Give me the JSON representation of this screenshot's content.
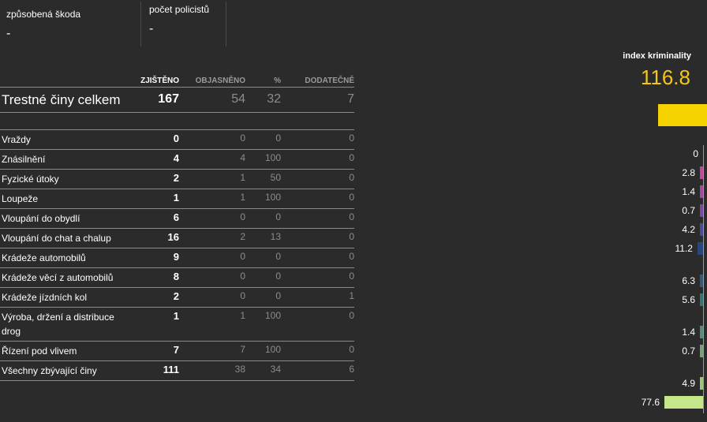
{
  "stats": [
    {
      "label": "způsobená škoda",
      "value": "-"
    },
    {
      "label": "počet policistů",
      "value": "-"
    }
  ],
  "table": {
    "headers": [
      "ZJIŠTĚNO",
      "OBJASNĚNO",
      "%",
      "DODATEČNĚ"
    ],
    "total": {
      "name": "Trestné činy celkem",
      "values": [
        "167",
        "54",
        "32",
        "7"
      ]
    },
    "rows": [
      {
        "name": "Vraždy",
        "values": [
          "0",
          "0",
          "0",
          "0"
        ]
      },
      {
        "name": "Znásilnění",
        "values": [
          "4",
          "4",
          "100",
          "0"
        ]
      },
      {
        "name": "Fyzické útoky",
        "values": [
          "2",
          "1",
          "50",
          "0"
        ]
      },
      {
        "name": "Loupeže",
        "values": [
          "1",
          "1",
          "100",
          "0"
        ]
      },
      {
        "name": "Vloupání do obydlí",
        "values": [
          "6",
          "0",
          "0",
          "0"
        ]
      },
      {
        "name": "Vloupání do chat a chalup",
        "values": [
          "16",
          "2",
          "13",
          "0"
        ]
      },
      {
        "name": "Krádeže automobilů",
        "values": [
          "9",
          "0",
          "0",
          "0"
        ]
      },
      {
        "name": "Krádeže věcí z automobilů",
        "values": [
          "8",
          "0",
          "0",
          "0"
        ]
      },
      {
        "name": "Krádeže jízdních kol",
        "values": [
          "2",
          "0",
          "0",
          "1"
        ]
      },
      {
        "name": "Výroba, držení a distribuce drog",
        "values": [
          "1",
          "1",
          "100",
          "0"
        ]
      },
      {
        "name": "Řízení pod vlivem",
        "values": [
          "7",
          "7",
          "100",
          "0"
        ]
      },
      {
        "name": "Všechny zbývající činy",
        "values": [
          "111",
          "38",
          "34",
          "6"
        ]
      }
    ]
  },
  "index": {
    "label": "index kriminality",
    "value": "116.8",
    "color": "#f5c518"
  },
  "chart_data": {
    "type": "bar",
    "categories": [
      "Vraždy",
      "Znásilnění",
      "Fyzické útoky",
      "Loupeže",
      "Vloupání do obydlí",
      "Vloupání do chat a chalup",
      "Krádeže automobilů",
      "Krádeže věcí z automobilů",
      "Krádeže jízdních kol",
      "Výroba, držení a distribuce drog",
      "Řízení pod vlivem",
      "Všechny zbývající činy"
    ],
    "values": [
      0,
      2.8,
      1.4,
      0.7,
      4.2,
      11.2,
      6.3,
      5.6,
      1.4,
      0.7,
      4.9,
      77.6
    ],
    "labels": [
      "0",
      "2.8",
      "1.4",
      "0.7",
      "4.2",
      "11.2",
      "6.3",
      "5.6",
      "1.4",
      "0.7",
      "4.9",
      "77.6"
    ],
    "total": 116.8,
    "colors": [
      "#c04a9a",
      "#c04a9a",
      "#a04aa0",
      "#7a4aa0",
      "#4a4a9a",
      "#27477a",
      "#2e5c7a",
      "#3a7272",
      "#5a8a7a",
      "#7aa07a",
      "#9ac47a",
      "#c6e68a"
    ]
  }
}
